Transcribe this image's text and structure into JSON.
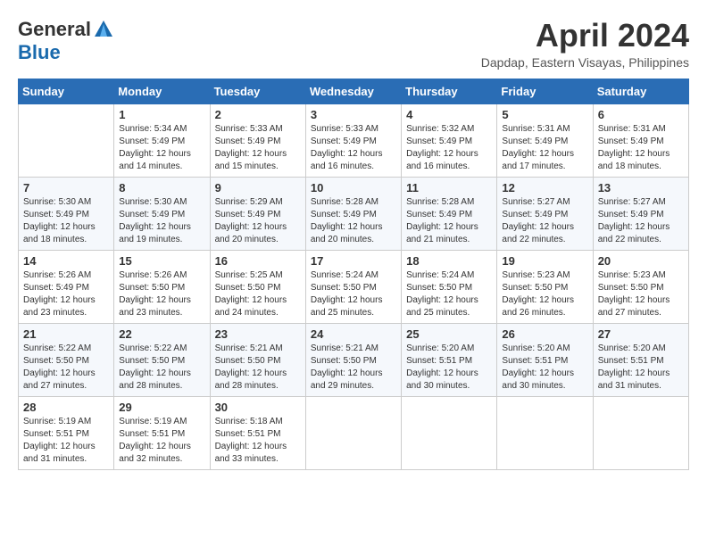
{
  "header": {
    "logo_general": "General",
    "logo_blue": "Blue",
    "month_title": "April 2024",
    "location": "Dapdap, Eastern Visayas, Philippines"
  },
  "weekdays": [
    "Sunday",
    "Monday",
    "Tuesday",
    "Wednesday",
    "Thursday",
    "Friday",
    "Saturday"
  ],
  "weeks": [
    [
      {
        "day": "",
        "sunrise": "",
        "sunset": "",
        "daylight": ""
      },
      {
        "day": "1",
        "sunrise": "Sunrise: 5:34 AM",
        "sunset": "Sunset: 5:49 PM",
        "daylight": "Daylight: 12 hours and 14 minutes."
      },
      {
        "day": "2",
        "sunrise": "Sunrise: 5:33 AM",
        "sunset": "Sunset: 5:49 PM",
        "daylight": "Daylight: 12 hours and 15 minutes."
      },
      {
        "day": "3",
        "sunrise": "Sunrise: 5:33 AM",
        "sunset": "Sunset: 5:49 PM",
        "daylight": "Daylight: 12 hours and 16 minutes."
      },
      {
        "day": "4",
        "sunrise": "Sunrise: 5:32 AM",
        "sunset": "Sunset: 5:49 PM",
        "daylight": "Daylight: 12 hours and 16 minutes."
      },
      {
        "day": "5",
        "sunrise": "Sunrise: 5:31 AM",
        "sunset": "Sunset: 5:49 PM",
        "daylight": "Daylight: 12 hours and 17 minutes."
      },
      {
        "day": "6",
        "sunrise": "Sunrise: 5:31 AM",
        "sunset": "Sunset: 5:49 PM",
        "daylight": "Daylight: 12 hours and 18 minutes."
      }
    ],
    [
      {
        "day": "7",
        "sunrise": "Sunrise: 5:30 AM",
        "sunset": "Sunset: 5:49 PM",
        "daylight": "Daylight: 12 hours and 18 minutes."
      },
      {
        "day": "8",
        "sunrise": "Sunrise: 5:30 AM",
        "sunset": "Sunset: 5:49 PM",
        "daylight": "Daylight: 12 hours and 19 minutes."
      },
      {
        "day": "9",
        "sunrise": "Sunrise: 5:29 AM",
        "sunset": "Sunset: 5:49 PM",
        "daylight": "Daylight: 12 hours and 20 minutes."
      },
      {
        "day": "10",
        "sunrise": "Sunrise: 5:28 AM",
        "sunset": "Sunset: 5:49 PM",
        "daylight": "Daylight: 12 hours and 20 minutes."
      },
      {
        "day": "11",
        "sunrise": "Sunrise: 5:28 AM",
        "sunset": "Sunset: 5:49 PM",
        "daylight": "Daylight: 12 hours and 21 minutes."
      },
      {
        "day": "12",
        "sunrise": "Sunrise: 5:27 AM",
        "sunset": "Sunset: 5:49 PM",
        "daylight": "Daylight: 12 hours and 22 minutes."
      },
      {
        "day": "13",
        "sunrise": "Sunrise: 5:27 AM",
        "sunset": "Sunset: 5:49 PM",
        "daylight": "Daylight: 12 hours and 22 minutes."
      }
    ],
    [
      {
        "day": "14",
        "sunrise": "Sunrise: 5:26 AM",
        "sunset": "Sunset: 5:49 PM",
        "daylight": "Daylight: 12 hours and 23 minutes."
      },
      {
        "day": "15",
        "sunrise": "Sunrise: 5:26 AM",
        "sunset": "Sunset: 5:50 PM",
        "daylight": "Daylight: 12 hours and 23 minutes."
      },
      {
        "day": "16",
        "sunrise": "Sunrise: 5:25 AM",
        "sunset": "Sunset: 5:50 PM",
        "daylight": "Daylight: 12 hours and 24 minutes."
      },
      {
        "day": "17",
        "sunrise": "Sunrise: 5:24 AM",
        "sunset": "Sunset: 5:50 PM",
        "daylight": "Daylight: 12 hours and 25 minutes."
      },
      {
        "day": "18",
        "sunrise": "Sunrise: 5:24 AM",
        "sunset": "Sunset: 5:50 PM",
        "daylight": "Daylight: 12 hours and 25 minutes."
      },
      {
        "day": "19",
        "sunrise": "Sunrise: 5:23 AM",
        "sunset": "Sunset: 5:50 PM",
        "daylight": "Daylight: 12 hours and 26 minutes."
      },
      {
        "day": "20",
        "sunrise": "Sunrise: 5:23 AM",
        "sunset": "Sunset: 5:50 PM",
        "daylight": "Daylight: 12 hours and 27 minutes."
      }
    ],
    [
      {
        "day": "21",
        "sunrise": "Sunrise: 5:22 AM",
        "sunset": "Sunset: 5:50 PM",
        "daylight": "Daylight: 12 hours and 27 minutes."
      },
      {
        "day": "22",
        "sunrise": "Sunrise: 5:22 AM",
        "sunset": "Sunset: 5:50 PM",
        "daylight": "Daylight: 12 hours and 28 minutes."
      },
      {
        "day": "23",
        "sunrise": "Sunrise: 5:21 AM",
        "sunset": "Sunset: 5:50 PM",
        "daylight": "Daylight: 12 hours and 28 minutes."
      },
      {
        "day": "24",
        "sunrise": "Sunrise: 5:21 AM",
        "sunset": "Sunset: 5:50 PM",
        "daylight": "Daylight: 12 hours and 29 minutes."
      },
      {
        "day": "25",
        "sunrise": "Sunrise: 5:20 AM",
        "sunset": "Sunset: 5:51 PM",
        "daylight": "Daylight: 12 hours and 30 minutes."
      },
      {
        "day": "26",
        "sunrise": "Sunrise: 5:20 AM",
        "sunset": "Sunset: 5:51 PM",
        "daylight": "Daylight: 12 hours and 30 minutes."
      },
      {
        "day": "27",
        "sunrise": "Sunrise: 5:20 AM",
        "sunset": "Sunset: 5:51 PM",
        "daylight": "Daylight: 12 hours and 31 minutes."
      }
    ],
    [
      {
        "day": "28",
        "sunrise": "Sunrise: 5:19 AM",
        "sunset": "Sunset: 5:51 PM",
        "daylight": "Daylight: 12 hours and 31 minutes."
      },
      {
        "day": "29",
        "sunrise": "Sunrise: 5:19 AM",
        "sunset": "Sunset: 5:51 PM",
        "daylight": "Daylight: 12 hours and 32 minutes."
      },
      {
        "day": "30",
        "sunrise": "Sunrise: 5:18 AM",
        "sunset": "Sunset: 5:51 PM",
        "daylight": "Daylight: 12 hours and 33 minutes."
      },
      {
        "day": "",
        "sunrise": "",
        "sunset": "",
        "daylight": ""
      },
      {
        "day": "",
        "sunrise": "",
        "sunset": "",
        "daylight": ""
      },
      {
        "day": "",
        "sunrise": "",
        "sunset": "",
        "daylight": ""
      },
      {
        "day": "",
        "sunrise": "",
        "sunset": "",
        "daylight": ""
      }
    ]
  ]
}
